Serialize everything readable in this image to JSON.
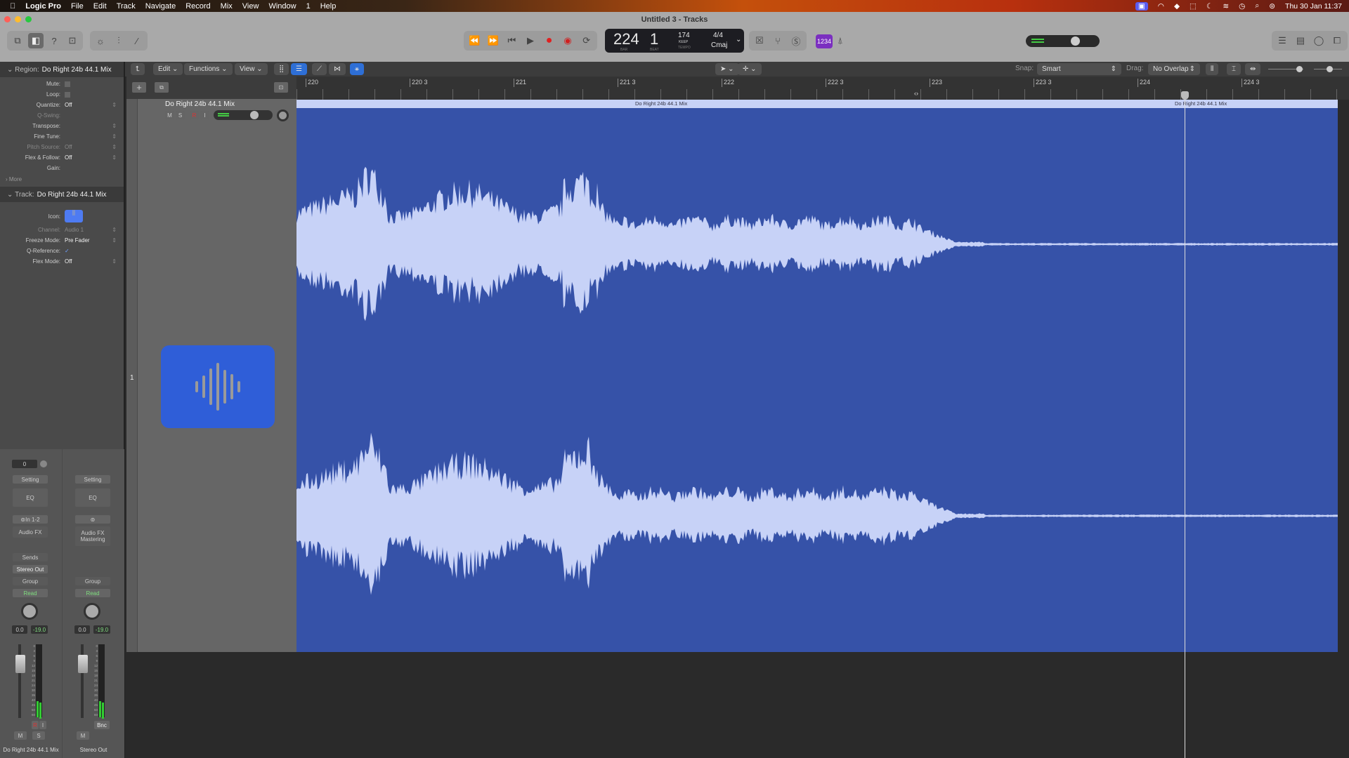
{
  "menubar": {
    "app": "Logic Pro",
    "items": [
      "File",
      "Edit",
      "Track",
      "Navigate",
      "Record",
      "Mix",
      "View",
      "Window",
      "1",
      "Help"
    ],
    "clock": "Thu 30 Jan  11:37"
  },
  "window": {
    "title": "Untitled 3 - Tracks"
  },
  "lcd": {
    "bar": "224",
    "beat": "1",
    "bar_label": "BAR",
    "beat_label": "BEAT",
    "tempo": "174",
    "tempo_mode": "KEEP",
    "tempo_label": "TEMPO",
    "signature": "4/4",
    "key": "Cmaj"
  },
  "count_in": "1234",
  "toolbar": {
    "edit": "Edit",
    "functions": "Functions",
    "view": "View",
    "snap_label": "Snap:",
    "snap": "Smart",
    "drag_label": "Drag:",
    "drag": "No Overlap"
  },
  "inspector": {
    "region_label": "Region:",
    "region_name": "Do Right 24b 44.1 Mix",
    "region_rows": [
      {
        "k": "Mute:",
        "v": ""
      },
      {
        "k": "Loop:",
        "v": ""
      },
      {
        "k": "Quantize:",
        "v": "Off"
      },
      {
        "k": "Q-Swing:",
        "v": ""
      },
      {
        "k": "Transpose:",
        "v": ""
      },
      {
        "k": "Fine Tune:",
        "v": ""
      },
      {
        "k": "Pitch Source:",
        "v": "Off"
      },
      {
        "k": "Flex & Follow:",
        "v": "Off"
      },
      {
        "k": "Gain:",
        "v": ""
      }
    ],
    "more": "More",
    "track_label": "Track:",
    "track_name": "Do Right 24b 44.1 Mix",
    "track_rows": [
      {
        "k": "Icon:",
        "v": ""
      },
      {
        "k": "Channel:",
        "v": "Audio 1"
      },
      {
        "k": "Freeze Mode:",
        "v": "Pre Fader"
      },
      {
        "k": "Q-Reference:",
        "v": "✓"
      },
      {
        "k": "Flex Mode:",
        "v": "Off"
      }
    ]
  },
  "strips": [
    {
      "name": "Do Right 24b 44.1 Mix",
      "gain": "0",
      "setting": "Setting",
      "eq": "EQ",
      "input": "In 1-2",
      "fx": "Audio FX",
      "fx2": "",
      "sends": "Sends",
      "output": "Stereo Out",
      "group": "Group",
      "automation": "Read",
      "volume": "0.0",
      "peak": "-19.0",
      "mute": "M",
      "solo": "S",
      "rec": "R",
      "inmon": "I"
    },
    {
      "name": "Stereo Out",
      "setting": "Setting",
      "eq": "EQ",
      "input": "",
      "fx": "Audio FX",
      "fx2": "Mastering",
      "output": "",
      "group": "Group",
      "automation": "Read",
      "volume": "0.0",
      "peak": "-19.0",
      "mute": "M",
      "bounce": "Bnc"
    }
  ],
  "meter_scale": [
    "0",
    "3",
    "6",
    "9",
    "12",
    "15",
    "18",
    "21",
    "24",
    "30",
    "35",
    "40",
    "45",
    "50",
    "60"
  ],
  "track": {
    "number": "1",
    "name": "Do Right 24b 44.1 Mix",
    "mute": "M",
    "solo": "S",
    "rec": "R",
    "input": "I",
    "icon_color": "#2f5ed8"
  },
  "ruler": [
    "220",
    "220 3",
    "221",
    "221 3",
    "222",
    "222 3",
    "223",
    "223 3",
    "224",
    "224 3"
  ],
  "regions": [
    {
      "name": "Do Right 24b 44.1 Mix"
    },
    {
      "name": "Do Right 24b 44.1 Mix"
    }
  ],
  "colors": {
    "region": "#3652a8",
    "waveform": "#c7d2f7",
    "region_header": "#c7d2f7"
  }
}
